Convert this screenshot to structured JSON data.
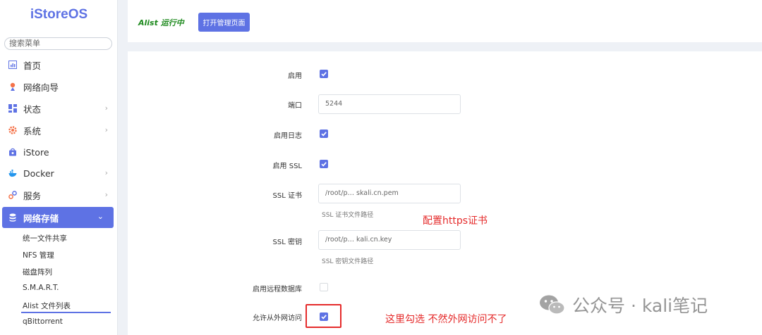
{
  "sidebar": {
    "logo": "iStoreOS",
    "search_placeholder": "搜索菜单",
    "items": [
      {
        "label": "首页",
        "icon": "dashboard-icon"
      },
      {
        "label": "网络向导",
        "icon": "wizard-icon"
      },
      {
        "label": "状态",
        "icon": "status-icon"
      },
      {
        "label": "系统",
        "icon": "gear-icon"
      },
      {
        "label": "iStore",
        "icon": "store-icon"
      },
      {
        "label": "Docker",
        "icon": "docker-icon"
      },
      {
        "label": "服务",
        "icon": "services-icon"
      },
      {
        "label": "网络存储",
        "icon": "storage-icon"
      }
    ],
    "sub_items": [
      "统一文件共享",
      "NFS 管理",
      "磁盘阵列",
      "S.M.A.R.T.",
      "Alist 文件列表",
      "qBittorrent"
    ]
  },
  "top": {
    "status": "Alist 运行中",
    "open_button": "打开管理页面"
  },
  "form": {
    "enable_label": "启用",
    "port_label": "端口",
    "port_value": "5244",
    "log_label": "启用日志",
    "ssl_label": "启用 SSL",
    "cert_label": "SSL 证书",
    "cert_value": "/root/p… skali.cn.pem",
    "cert_help": "SSL 证书文件路径",
    "key_label": "SSL 密钥",
    "key_value": "/root/p… kali.cn.key",
    "key_help": "SSL 密钥文件路径",
    "remote_db_label": "启用远程数据库",
    "external_label": "允许从外网访问"
  },
  "annotations": {
    "https_note": "配置https证书",
    "check_note": "这里勾选 不然外网访问不了"
  },
  "watermark": "公众号 · kali笔记",
  "colors": {
    "accent": "#5e72e4",
    "annotation": "#e52b2b",
    "running": "#1e8a1e"
  }
}
